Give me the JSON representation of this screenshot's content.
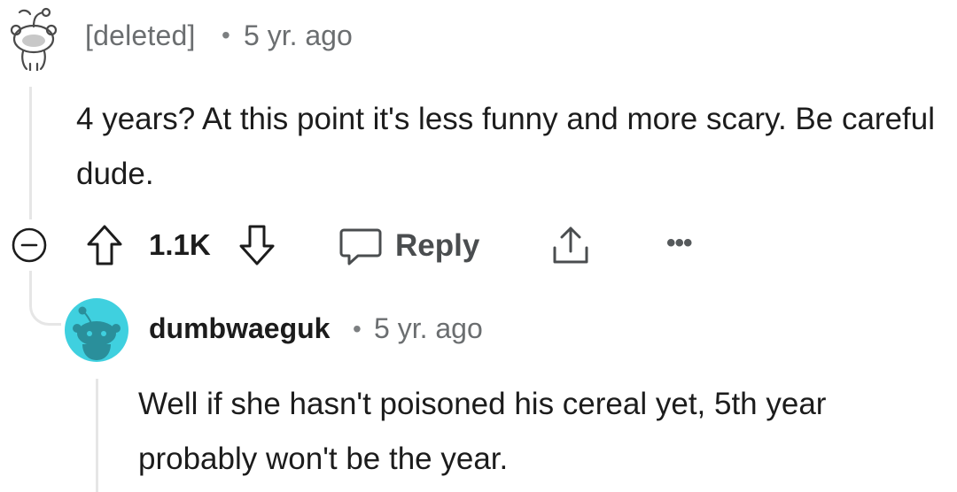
{
  "comment": {
    "author": "[deleted]",
    "separator": "•",
    "time": "5 yr. ago",
    "body": "4 years? At this point it's less funny and more scary. Be careful dude.",
    "score": "1.1K",
    "reply_label": "Reply",
    "more_label": "•••"
  },
  "reply": {
    "author": "dumbwaeguk",
    "separator": "•",
    "time": "5 yr. ago",
    "body": "Well if she hasn't poisoned his cereal yet, 5th year probably won't be the year.",
    "avatar_color": "#3fd0df"
  },
  "icons": {
    "deleted_avatar": "snoo-outline-avatar-icon",
    "collapse": "collapse-minus-icon",
    "upvote": "arrow-up-icon",
    "downvote": "arrow-down-icon",
    "reply": "speech-bubble-icon",
    "share": "share-upload-icon",
    "more": "more-dots-icon",
    "reply_avatar": "snoo-avatar-icon"
  },
  "colors": {
    "text_primary": "#1c1c1c",
    "text_meta": "#6b6e70",
    "thread_line": "#e6e6e6"
  }
}
